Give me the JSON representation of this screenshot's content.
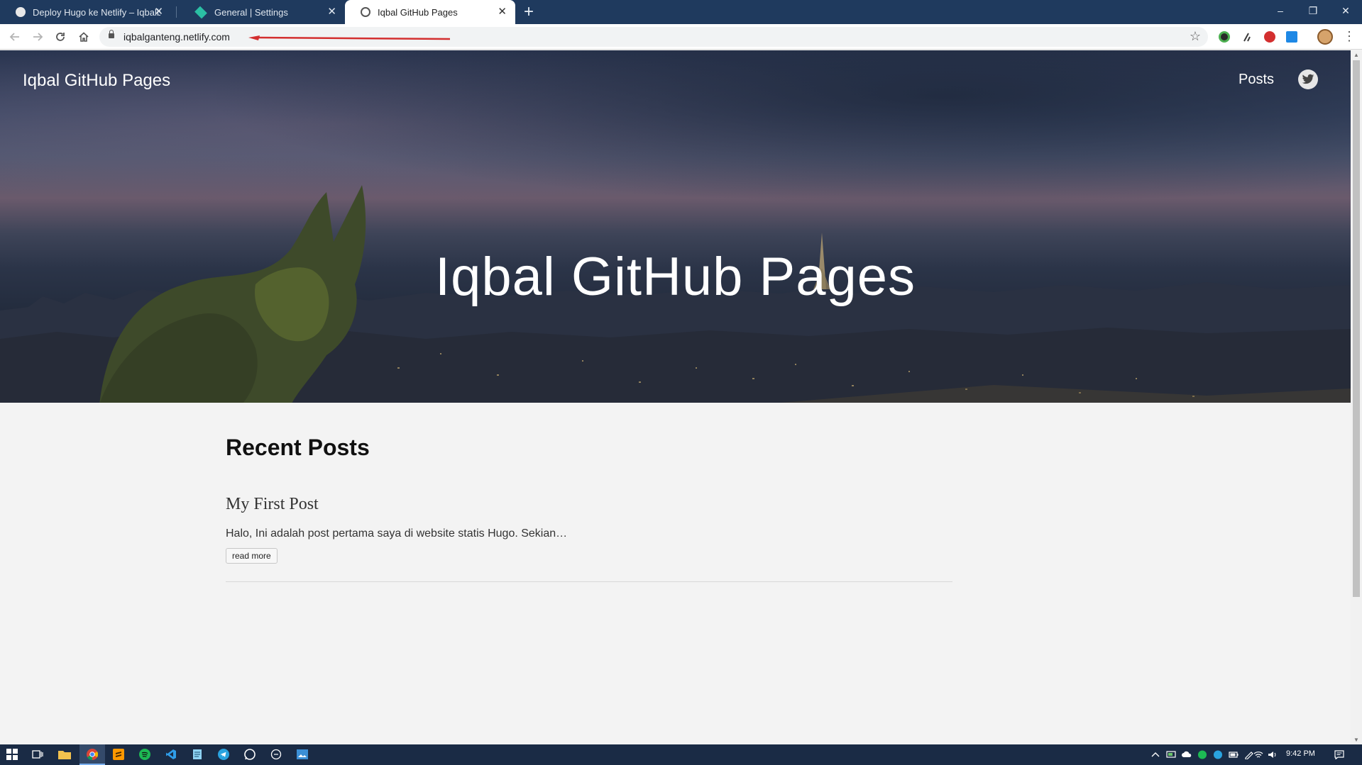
{
  "browser": {
    "tabs": [
      {
        "title": "Deploy Hugo ke Netlify – Iqbalb",
        "favicon": "circle-favicon-icon",
        "active": false
      },
      {
        "title": "General | Settings",
        "favicon": "netlify-diamond-icon",
        "active": false
      },
      {
        "title": "Iqbal GitHub Pages",
        "favicon": "globe-icon",
        "active": true
      }
    ],
    "new_tab_symbol": "+",
    "url": "iqbalganteng.netlify.com",
    "annotation_arrow_color": "#d32f2f",
    "window_controls": {
      "minimize": "–",
      "restore": "❐",
      "close": "✕"
    }
  },
  "site": {
    "brand": "Iqbal GitHub Pages",
    "nav_posts": "Posts",
    "social_icon": "twitter-icon",
    "hero_title": "Iqbal GitHub Pages",
    "section_title": "Recent Posts",
    "posts": [
      {
        "title": "My First Post",
        "summary": "Halo, Ini adalah post pertama saya di website statis Hugo. Sekian…",
        "read_more": "read more"
      }
    ]
  },
  "taskbar": {
    "apps": [
      "windows-start-icon",
      "task-view-icon",
      "file-explorer-icon",
      "chrome-icon",
      "sublime-text-icon",
      "spotify-icon",
      "vscode-icon",
      "notepad-icon",
      "telegram-icon",
      "whatsapp-icon",
      "cortana-icon",
      "photos-icon"
    ],
    "clock": "9:42 PM"
  },
  "colors": {
    "tabbar": "#1f3a5e",
    "taskbar": "#1a2b45",
    "page_background": "#f3f3f3"
  }
}
